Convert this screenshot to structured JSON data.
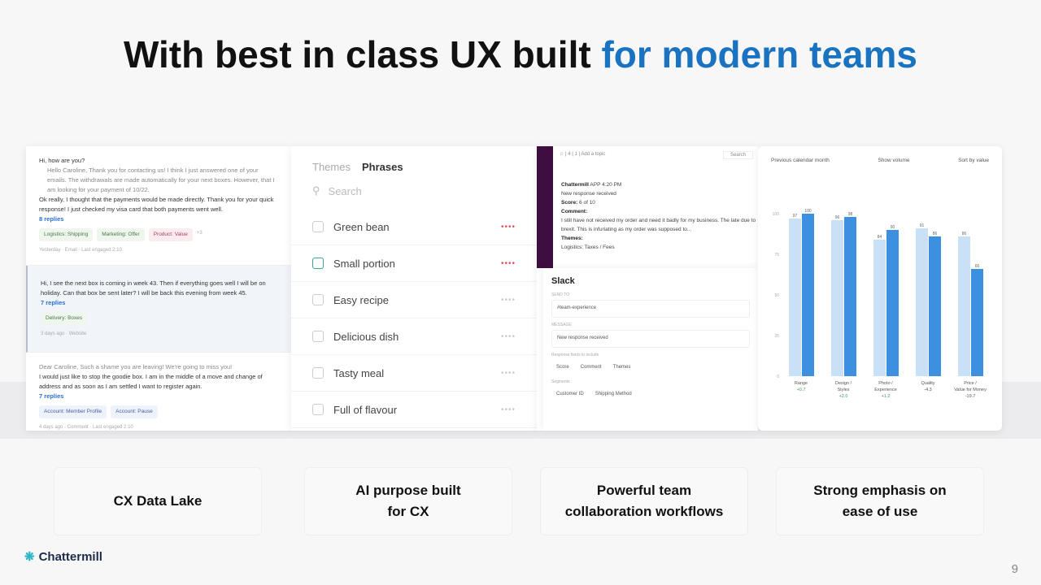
{
  "title": {
    "main": "With best in class UX built ",
    "accent": "for modern teams"
  },
  "conversations": [
    {
      "greeting": "Hi, how are you?",
      "reply": "Hello Caroline, Thank you for contacting us! I think I just answered one of your emails. The withdrawals are made automatically for your next boxes. However, that I am looking for your payment of 10/22.",
      "text": "Ok really, I thought that the payments would be made directly. Thank you for your quick response! I just checked my visa card that both payments went well.",
      "replies": "8 replies",
      "tags": [
        "Logistics: Shipping",
        "Marketing: Offer",
        "Product: Value"
      ],
      "more": "+3",
      "meta": "Yesterday · Email · Last engaged 2:10"
    },
    {
      "text": "Hi, I see the next box is coming in week 43. Then if everything goes well I will be on holiday. Can that box be sent later? I will be back this evening from week 45.",
      "replies": "7 replies",
      "tags": [
        "Delivery: Boxes"
      ],
      "meta": "3 days ago · Website"
    },
    {
      "reply": "Dear Caroline, Such a shame you are leaving! We're going to miss you!",
      "text": "I would just like to stop the goodie box. I am in the middle of a move and change of address and as soon as I am settled I want to register again.",
      "replies": "7 replies",
      "tags": [
        "Account: Member Profile",
        "Account: Pause"
      ],
      "meta": "4 days ago · Comment · Last engaged 2:10"
    }
  ],
  "phrases": {
    "tabs": [
      "Themes",
      "Phrases"
    ],
    "search_placeholder": "Search",
    "items": [
      "Green bean",
      "Small portion",
      "Easy recipe",
      "Delicious dish",
      "Tasty meal",
      "Full of flavour"
    ]
  },
  "slack": {
    "toolbar": "☆ | 4 | 1 | Add a topic",
    "search": "Search",
    "sender": "Chattermill",
    "app": "APP",
    "time": "4:20 PM",
    "message": "New response received",
    "score_label": "Score:",
    "score": "6 of 10",
    "comment_label": "Comment:",
    "comment": "I still have not received my order and need it badly for my business. The late due to brexit. This is infuriating as my order was supposed to...",
    "themes_label": "Themes:",
    "theme": "Logistics: Taxes / Fees",
    "card_title": "Slack",
    "send_to_label": "SEND TO",
    "send_to": "#team-experience",
    "message_label": "MESSAGE",
    "message_value": "New response received",
    "fields_label": "Response fields to include",
    "fields": [
      "Score",
      "Comment",
      "Themes"
    ],
    "segments_label": "Segments",
    "segments": [
      "Customer ID",
      "Shipping Method"
    ]
  },
  "chart_data": {
    "type": "bar",
    "controls": [
      "Previous calendar month",
      "Show volume",
      "Sort by value"
    ],
    "categories": [
      "Range",
      "Design / Styles",
      "Photo / Experience",
      "Quality",
      "Price / Value for Money"
    ],
    "deltas": [
      "+0.7",
      "+2.0",
      "+1.2",
      "-4.3",
      "-19.7"
    ],
    "series": [
      {
        "values": [
          97,
          96,
          84,
          91,
          86
        ]
      },
      {
        "values": [
          100,
          98,
          90,
          86,
          66
        ]
      }
    ],
    "ylim": [
      0,
      100
    ],
    "yticks": [
      0,
      25,
      50,
      75,
      100
    ],
    "colors": [
      "#c9e1f7",
      "#3d8fe0"
    ]
  },
  "features": [
    "CX Data Lake",
    "AI purpose  built\nfor CX",
    "Powerful team\ncollaboration  workflows",
    "Strong emphasis on\nease of use"
  ],
  "brand": "Chattermill",
  "page_number": "9"
}
